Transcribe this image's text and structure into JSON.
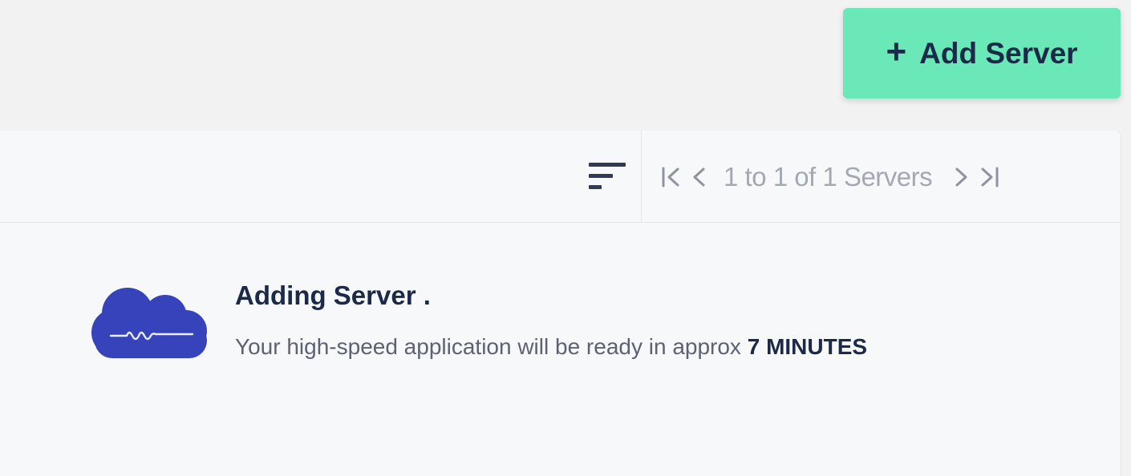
{
  "header": {
    "add_server_label": "Add Server",
    "add_server_icon": "plus-icon",
    "accent_color": "#6be8b7"
  },
  "toolbar": {
    "sort_icon": "sort-lines-icon",
    "pagination": {
      "first_icon": "first-page-icon",
      "prev_icon": "chevron-left-icon",
      "count_text": "1 to 1 of 1 Servers",
      "next_icon": "chevron-right-icon",
      "last_icon": "last-page-icon"
    }
  },
  "status": {
    "icon": "cloud-icon",
    "icon_color": "#3643ba",
    "title": "Adding Server .",
    "message_prefix": "Your high-speed application will be ready in approx",
    "message_time": "7 MINUTES"
  }
}
